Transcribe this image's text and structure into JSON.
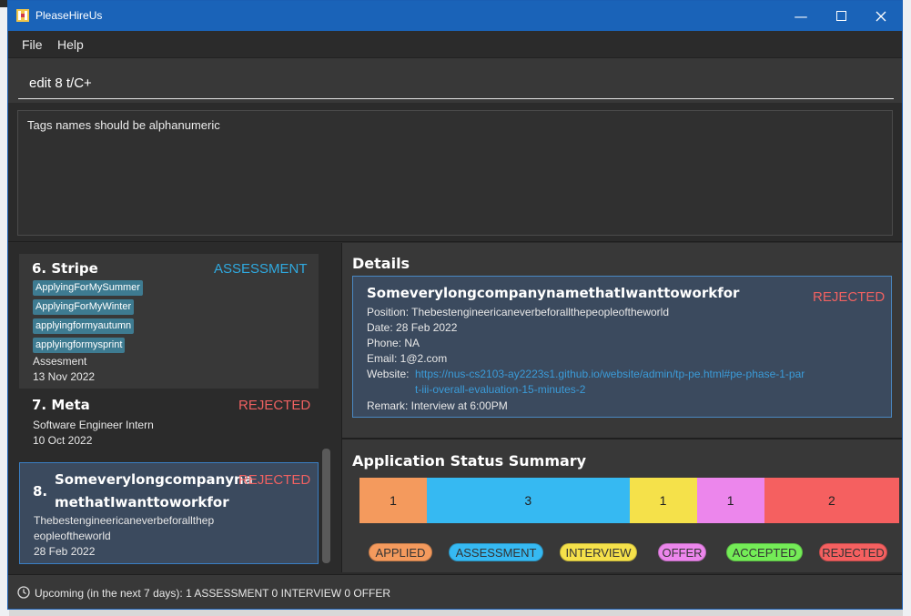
{
  "window": {
    "title": "PleaseHireUs"
  },
  "menu": {
    "file": "File",
    "help": "Help"
  },
  "command": {
    "value": "edit 8 t/C+"
  },
  "result": {
    "message": "Tags names should be alphanumeric"
  },
  "list": [
    {
      "index_name": "6.  Stripe",
      "status": "ASSESSMENT",
      "status_color": "#2fa9df",
      "tags": [
        "ApplyingForMySummer",
        "ApplyingForMyWinter",
        "applyingformyautumn",
        "applyingformysprint"
      ],
      "position": "Assesment",
      "date": "13 Nov 2022"
    },
    {
      "index_name": "7.  Meta",
      "status": "REJECTED",
      "status_color": "#ef6161",
      "position": "Software Engineer Intern",
      "date": "10 Oct 2022"
    },
    {
      "index": "8.",
      "name_line1": "Someverylongcompanyna",
      "name_line2": "methatIwanttoworkfor",
      "status": "REJECTED",
      "status_color": "#ef6161",
      "position_line1": "Thebestengineericaneverbeforallthep",
      "position_line2": "eopleoftheworld",
      "date": "28 Feb 2022"
    }
  ],
  "details": {
    "heading": "Details",
    "company": "SomeverylongcompanynamethatIwanttoworkfor",
    "status": "REJECTED",
    "position": "Position: Thebestengineericaneverbeforallthepeopleoftheworld",
    "date": "Date: 28 Feb 2022",
    "phone": "Phone: NA",
    "email": "Email: 1@2.com",
    "website_label": "Website: ",
    "website_url": "https://nus-cs2103-ay2223s1.github.io/website/admin/tp-pe.html#pe-phase-1-part-iii-overall-evaluation-15-minutes-2",
    "remark": "Remark: Interview at 6:00PM"
  },
  "summary": {
    "heading": "Application Status Summary",
    "counts": [
      {
        "status": "APPLIED",
        "value": 1,
        "color": "#f49a5d"
      },
      {
        "status": "ASSESSMENT",
        "value": 3,
        "color": "#36b9f2"
      },
      {
        "status": "INTERVIEW",
        "value": 1,
        "color": "#f5e14a"
      },
      {
        "status": "OFFER",
        "value": 1,
        "color": "#ec86ec"
      },
      {
        "status": "ACCEPTED",
        "value": 0,
        "color": "#74ec57"
      },
      {
        "status": "REJECTED",
        "value": 2,
        "color": "#f56060"
      }
    ],
    "legend": [
      "APPLIED",
      "ASSESSMENT",
      "INTERVIEW",
      "OFFER",
      "ACCEPTED",
      "REJECTED"
    ]
  },
  "statusbar": {
    "text": "Upcoming (in the next 7 days):  1 ASSESSMENT 0 INTERVIEW 0 OFFER"
  },
  "icons": {
    "app": "app-icon",
    "minimize": "minimize-icon",
    "maximize": "maximize-icon",
    "close": "close-icon",
    "clock": "clock-icon"
  }
}
